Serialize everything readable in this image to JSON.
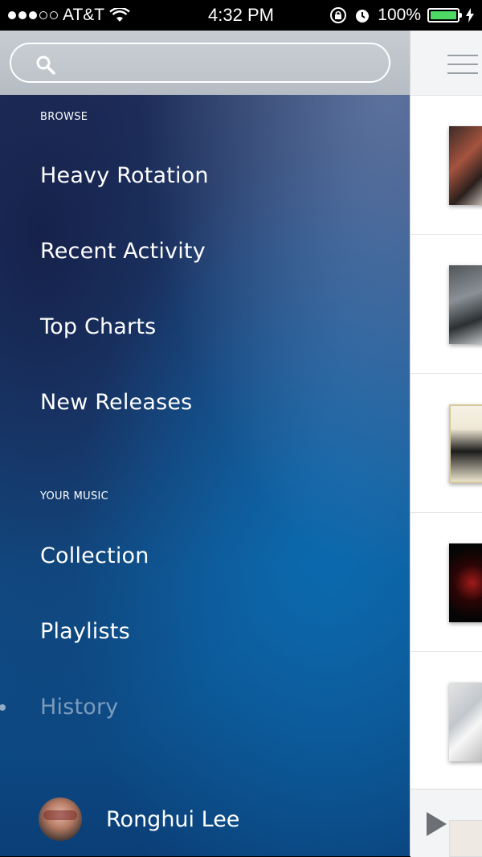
{
  "status_bar": {
    "carrier": "AT&T",
    "time": "4:32 PM",
    "battery": "100%",
    "signal_dots_filled": 3,
    "signal_dots_total": 5
  },
  "search": {
    "placeholder": ""
  },
  "sidebar": {
    "browse_label": "BROWSE",
    "browse_items": [
      {
        "label": "Heavy Rotation"
      },
      {
        "label": "Recent Activity"
      },
      {
        "label": "Top Charts"
      },
      {
        "label": "New Releases"
      }
    ],
    "your_music_label": "YOUR MUSIC",
    "your_music_items": [
      {
        "label": "Collection"
      },
      {
        "label": "Playlists"
      },
      {
        "label": "History"
      }
    ]
  },
  "profile": {
    "name": "Ronghui Lee"
  },
  "colors": {
    "battery_fill": "#4cd964",
    "sidebar_accent": "#0f5a98"
  }
}
